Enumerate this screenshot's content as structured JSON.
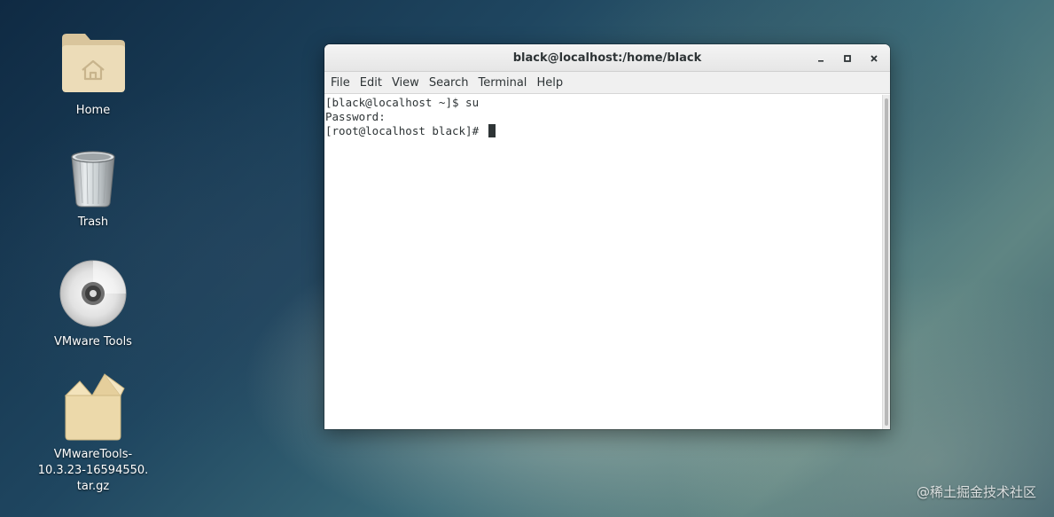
{
  "desktop": {
    "icons": [
      {
        "label": "Home",
        "icon": "home-folder-icon"
      },
      {
        "label": "Trash",
        "icon": "trash-icon"
      },
      {
        "label": "VMware Tools",
        "icon": "cd-disc-icon"
      },
      {
        "label": "VMwareTools-\n10.3.23-16594550.\ntar.gz",
        "icon": "archive-package-icon"
      }
    ]
  },
  "window": {
    "title": "black@localhost:/home/black",
    "controls": {
      "minimize": "–",
      "maximize": "▫",
      "close": "×"
    },
    "menu": [
      "File",
      "Edit",
      "View",
      "Search",
      "Terminal",
      "Help"
    ],
    "terminal_lines": [
      "[black@localhost ~]$ su",
      "Password:",
      "[root@localhost black]# "
    ]
  },
  "watermark": "@稀土掘金技术社区",
  "colors": {
    "folder": "#e8d7b2",
    "terminal_text": "#2e3436",
    "titlebar": "#ececec"
  }
}
